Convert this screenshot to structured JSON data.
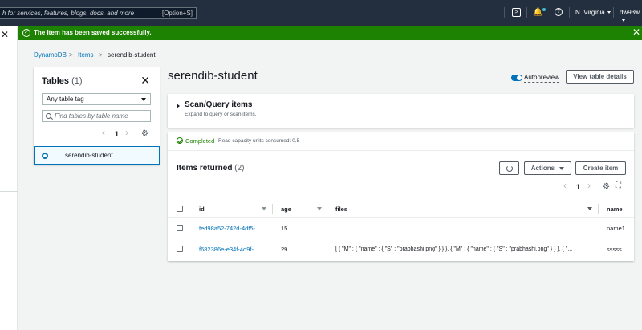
{
  "topbar": {
    "search_placeholder": "h for services, features, blogs, docs, and more",
    "search_shortcut": "[Option+S]",
    "region": "N. Virginia",
    "account": "dw93w"
  },
  "flash": {
    "message": "The item has been saved successfully."
  },
  "breadcrumb": [
    "DynamoDB",
    "Items",
    "serendib-student"
  ],
  "tables_panel": {
    "title": "Tables",
    "count": "(1)",
    "filter_value": "Any table tag",
    "search_placeholder": "Find tables by table name",
    "page": "1",
    "tables": [
      {
        "name": "serendib-student",
        "selected": true
      }
    ]
  },
  "main": {
    "title": "serendib-student",
    "autopreview_label": "Autopreview",
    "view_details_label": "View table details"
  },
  "scan": {
    "title": "Scan/Query items",
    "subtitle": "Expand to query or scan items."
  },
  "results": {
    "status": "Completed",
    "rcu": "Read capacity units consumed: 0.5",
    "title": "Items returned",
    "count": "(2)",
    "actions_label": "Actions",
    "create_label": "Create item",
    "page": "1",
    "columns": [
      "id",
      "age",
      "files",
      "name"
    ],
    "rows": [
      {
        "id": "fed98a52-742d-4df5-...",
        "age": "15",
        "files": "",
        "name": "name1"
      },
      {
        "id": "f682386e-e34f-4d9f-...",
        "age": "29",
        "files": "[ { \"M\" : { \"name\" : { \"S\" : \"prabhashi.png\" } } }, { \"M\" : { \"name\" : { \"S\" : \"prabhashi.png\" } } }, { \"...",
        "name": "sssss"
      }
    ]
  },
  "colors": {
    "topbar": "#232f3e",
    "success": "#1d8102",
    "link": "#0073bb"
  }
}
